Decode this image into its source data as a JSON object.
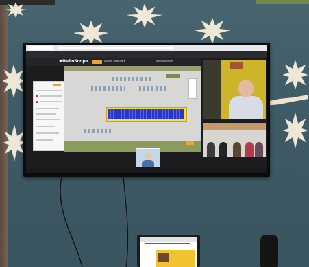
{
  "tv": {
    "app_title": "HelioScope",
    "logo_text": "✺HelioScope",
    "design_label": "Design Settings ▾",
    "new_design_label": "New Design ▾",
    "bottom_status": "",
    "sidebar_title": ""
  },
  "colors": {
    "wall": "#3f5b66",
    "accent_orange": "#f0a22c",
    "solar_array": "#2b36c6",
    "roof_yellow": "#f2e046",
    "video_tile_yellow": "#cdb52a"
  },
  "icons": [
    "snowflake-icon",
    "helioscope-logo-icon",
    "mic-icon",
    "camera-icon",
    "end-call-icon"
  ]
}
